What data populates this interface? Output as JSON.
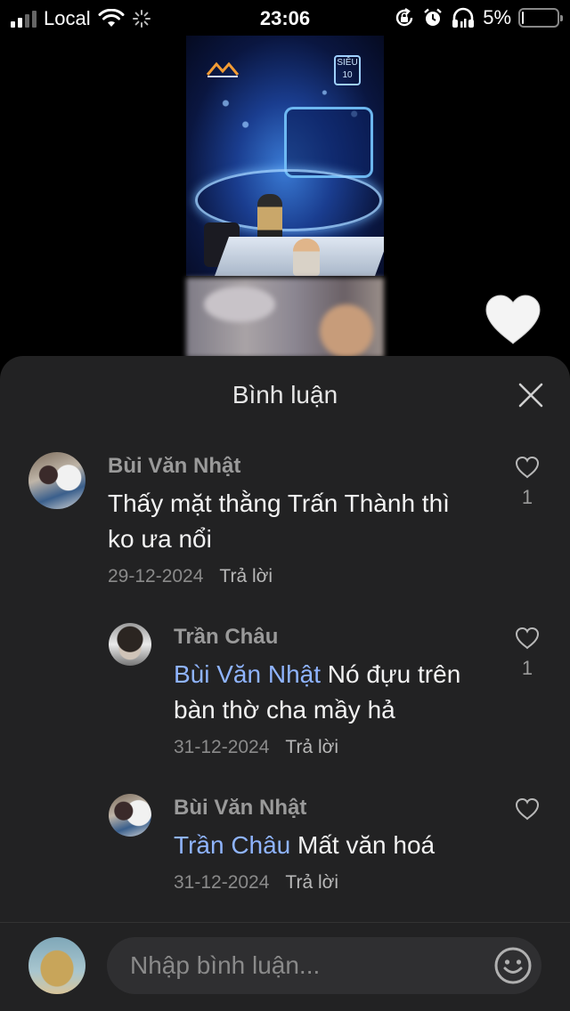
{
  "status_bar": {
    "carrier": "Local",
    "time": "23:06",
    "battery_percent": "5%",
    "battery_level": 0.05
  },
  "video": {
    "logo_right_text": "SIÊU 10"
  },
  "comments_sheet": {
    "title": "Bình luận",
    "comments": [
      {
        "author": "Bùi Văn Nhật",
        "text_line1": "Thấy mặt thằng Trấn Thành thì",
        "text_line2": "ko ưa nổi",
        "date": "29-12-2024",
        "reply_label": "Trả lời",
        "likes": "1"
      },
      {
        "author": "Trần Châu",
        "mention": "Bùi Văn Nhật",
        "text_line1": " Nó đựu trên",
        "text_line2": "bàn thờ cha mầy hả",
        "date": "31-12-2024",
        "reply_label": "Trả lời",
        "likes": "1"
      },
      {
        "author": "Bùi Văn Nhật",
        "mention": "Trần Châu",
        "text_line1": " Mất văn hoá",
        "date": "31-12-2024",
        "reply_label": "Trả lời",
        "likes": ""
      }
    ],
    "input": {
      "placeholder": "Nhập bình luận...",
      "value": ""
    }
  },
  "icons": [
    "signal-icon",
    "wifi-icon",
    "loading-icon",
    "orientation-lock-icon",
    "alarm-icon",
    "headphones-icon",
    "battery-icon",
    "heart-icon",
    "close-icon",
    "emoji-icon"
  ],
  "colors": {
    "sheet_background": "#222223",
    "mention": "#8fb4ff",
    "input_background": "#2f2f31"
  }
}
